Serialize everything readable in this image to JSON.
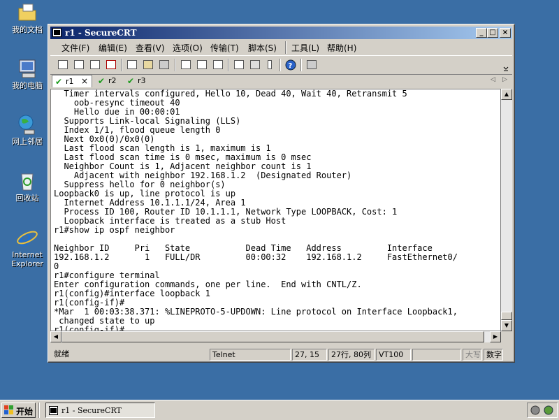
{
  "desktop": {
    "icons": [
      {
        "label": "我的文档",
        "icon": "my-documents-icon"
      },
      {
        "label": "我的电脑",
        "icon": "my-computer-icon"
      },
      {
        "label": "网上邻居",
        "icon": "network-places-icon"
      },
      {
        "label": "回收站",
        "icon": "recycle-bin-icon"
      },
      {
        "label": "Internet\nExplorer",
        "icon": "internet-explorer-icon"
      }
    ]
  },
  "window": {
    "title": "r1 - SecureCRT",
    "controls": {
      "minimize": "_",
      "maximize": "□",
      "close": "×"
    }
  },
  "menu": [
    "文件(F)",
    "编辑(E)",
    "查看(V)",
    "选项(O)",
    "传输(T)",
    "脚本(S)",
    "工具(L)",
    "帮助(H)"
  ],
  "toolbar": {
    "icons": [
      "connect-icon",
      "quick-connect-icon",
      "connect-tab-icon",
      "disconnect-icon",
      "copy-icon",
      "paste-icon",
      "find-icon",
      "print-icon",
      "print-setup-icon",
      "print-selection-icon",
      "session-options-icon",
      "global-options-icon",
      "keymap-icon",
      "help-icon",
      "sftp-icon"
    ]
  },
  "tabs": [
    {
      "label": "r1",
      "close": "×",
      "active": true
    },
    {
      "label": "r2",
      "active": false
    },
    {
      "label": "r3",
      "active": false
    }
  ],
  "terminal": {
    "lines": [
      "  Timer intervals configured, Hello 10, Dead 40, Wait 40, Retransmit 5",
      "    oob-resync timeout 40",
      "    Hello due in 00:00:01",
      "  Supports Link-local Signaling (LLS)",
      "  Index 1/1, flood queue length 0",
      "  Next 0x0(0)/0x0(0)",
      "  Last flood scan length is 1, maximum is 1",
      "  Last flood scan time is 0 msec, maximum is 0 msec",
      "  Neighbor Count is 1, Adjacent neighbor count is 1",
      "    Adjacent with neighbor 192.168.1.2  (Designated Router)",
      "  Suppress hello for 0 neighbor(s)",
      "Loopback0 is up, line protocol is up",
      "  Internet Address 10.1.1.1/24, Area 1",
      "  Process ID 100, Router ID 10.1.1.1, Network Type LOOPBACK, Cost: 1",
      "  Loopback interface is treated as a stub Host",
      "r1#show ip ospf neighbor",
      "",
      "Neighbor ID     Pri   State           Dead Time   Address         Interface",
      "192.168.1.2       1   FULL/DR         00:00:32    192.168.1.2     FastEthernet0/",
      "0",
      "r1#configure terminal",
      "Enter configuration commands, one per line.  End with CNTL/Z.",
      "r1(config)#interface loopback 1",
      "r1(config-if)#",
      "*Mar  1 00:03:38.371: %LINEPROTO-5-UPDOWN: Line protocol on Interface Loopback1,",
      " changed state to up",
      "r1(config-if)#"
    ]
  },
  "status": {
    "ready": "就绪",
    "protocol": "Telnet",
    "cursor": "27, 15",
    "size": "27行, 80列",
    "emulation": "VT100",
    "blank": "",
    "caps": "大写",
    "num": "数字"
  },
  "taskbar": {
    "start": "开始",
    "task": "r1 - SecureCRT"
  }
}
